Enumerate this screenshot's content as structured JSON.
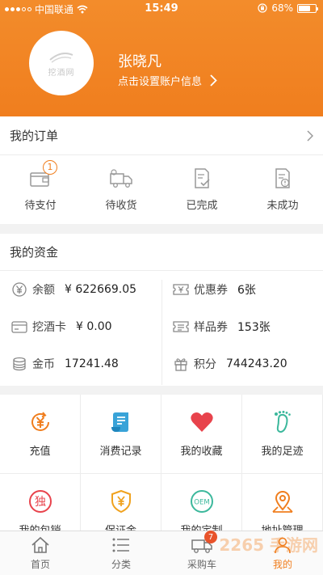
{
  "status_bar": {
    "carrier": "中国联通",
    "time": "15:49",
    "battery": "68%",
    "battery_level": 0.68
  },
  "profile": {
    "avatar_logo_text": "挖酒网",
    "name": "张晓凡",
    "account_link": "点击设置账户信息"
  },
  "orders": {
    "title": "我的订单",
    "items": [
      {
        "label": "待支付",
        "icon": "wallet-icon",
        "badge": "1"
      },
      {
        "label": "待收货",
        "icon": "truck-icon"
      },
      {
        "label": "已完成",
        "icon": "completed-doc-icon"
      },
      {
        "label": "未成功",
        "icon": "failed-doc-icon"
      }
    ]
  },
  "funds": {
    "title": "我的资金",
    "items": [
      {
        "label": "余额",
        "value": "¥ 622669.05",
        "icon": "yen-icon"
      },
      {
        "label": "优惠券",
        "value": "6张",
        "icon": "coupon-icon"
      },
      {
        "label": "挖酒卡",
        "value": "¥ 0.00",
        "icon": "card-icon"
      },
      {
        "label": "样品券",
        "value": "153张",
        "icon": "sample-ticket-icon"
      },
      {
        "label": "金币",
        "value": "17241.48",
        "icon": "coins-icon"
      },
      {
        "label": "积分",
        "value": "744243.20",
        "icon": "gift-icon"
      }
    ]
  },
  "features": [
    {
      "label": "充值",
      "icon": "recharge-icon"
    },
    {
      "label": "消费记录",
      "icon": "receipt-icon"
    },
    {
      "label": "我的收藏",
      "icon": "heart-icon"
    },
    {
      "label": "我的足迹",
      "icon": "footprint-icon"
    },
    {
      "label": "我的包销",
      "icon": "exclusive-icon",
      "glyph": "独"
    },
    {
      "label": "保证金",
      "icon": "shield-yen-icon"
    },
    {
      "label": "我的定制",
      "icon": "oem-icon",
      "glyph": "OEM"
    },
    {
      "label": "地址管理",
      "icon": "location-icon"
    }
  ],
  "tabbar": [
    {
      "label": "首页",
      "icon": "home-icon"
    },
    {
      "label": "分类",
      "icon": "list-icon"
    },
    {
      "label": "采购车",
      "icon": "cart-icon",
      "badge": "7"
    },
    {
      "label": "我的",
      "icon": "person-icon",
      "active": true
    }
  ],
  "watermark": "2265 手游网",
  "colors": {
    "accent": "#f07e1e",
    "badge": "#e8532b"
  }
}
